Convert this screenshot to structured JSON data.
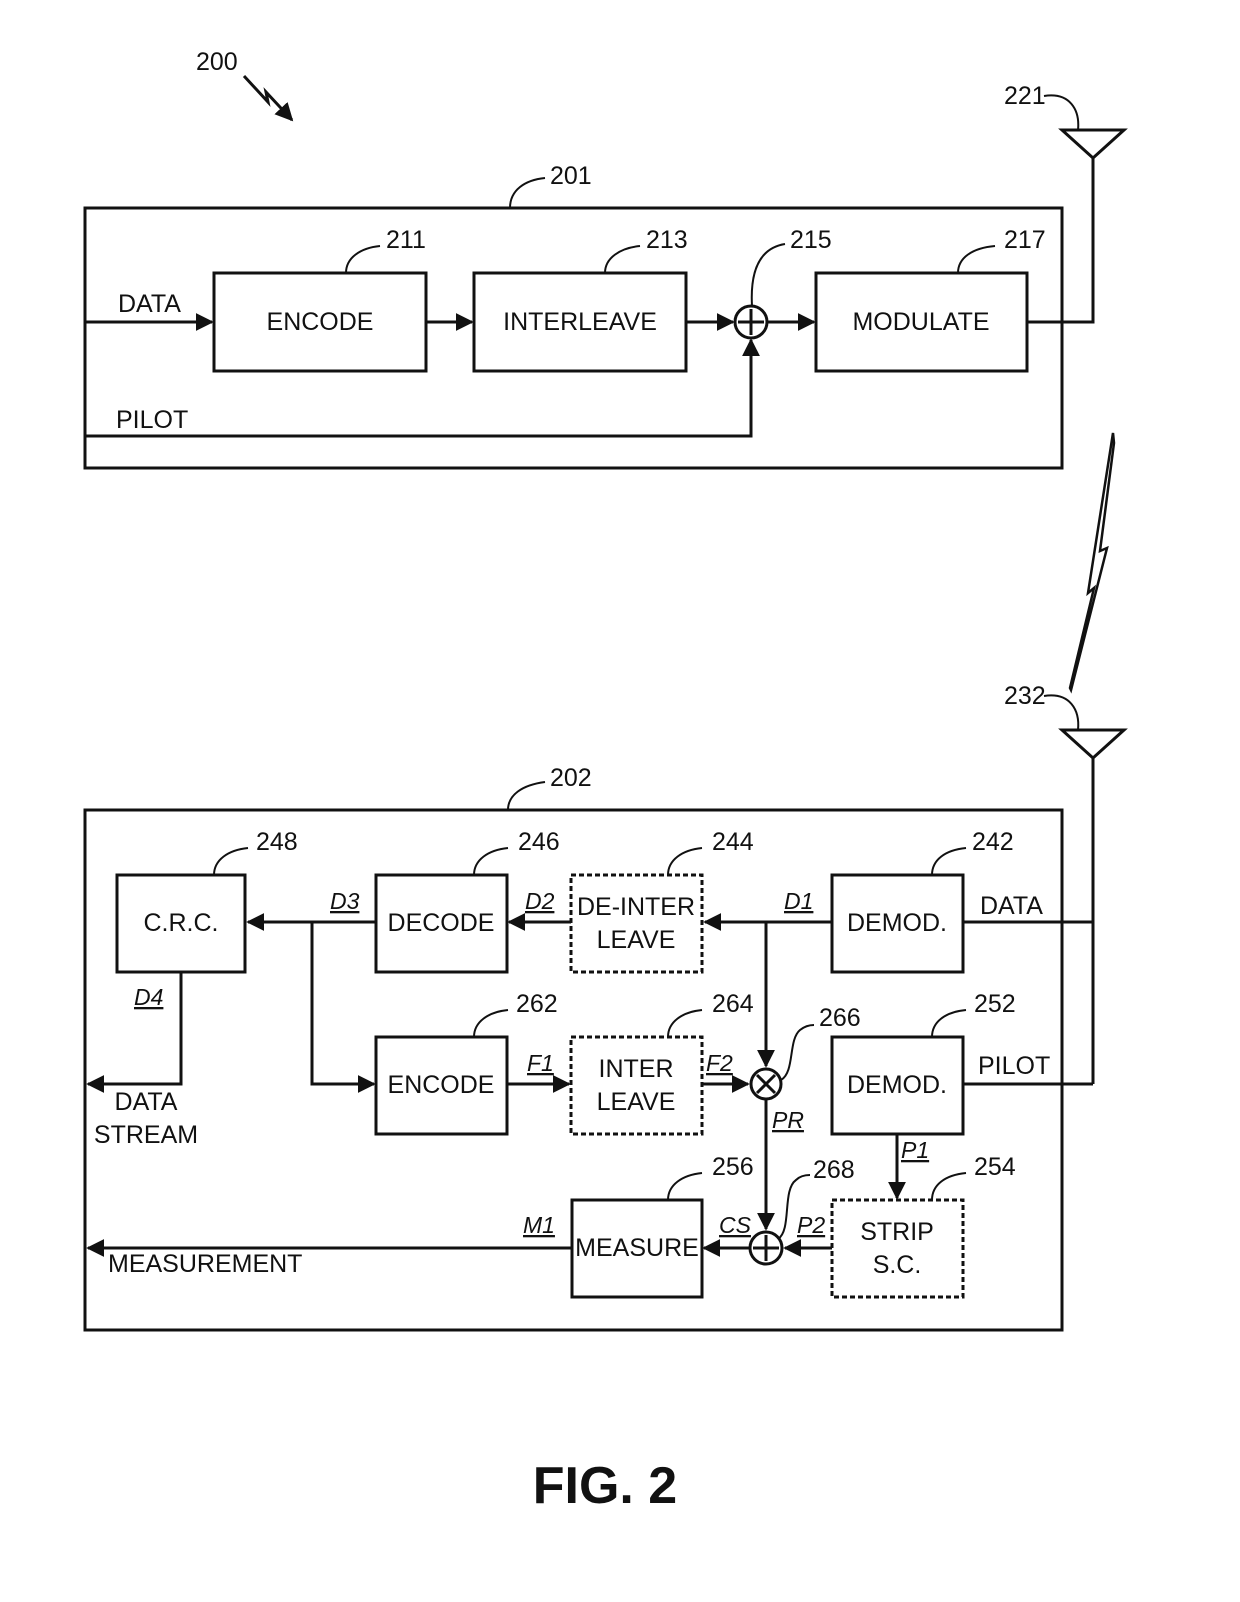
{
  "figure": {
    "label": "FIG. 2",
    "system_ref": "200"
  },
  "transmitter": {
    "ref": "201",
    "antenna_ref": "221",
    "inputs": {
      "data": "DATA",
      "pilot": "PILOT"
    },
    "blocks": {
      "encode": {
        "label": "ENCODE",
        "ref": "211"
      },
      "interleave": {
        "label": "INTERLEAVE",
        "ref": "213"
      },
      "adder": {
        "ref": "215"
      },
      "modulate": {
        "label": "MODULATE",
        "ref": "217"
      }
    }
  },
  "receiver": {
    "ref": "202",
    "antenna_ref": "232",
    "branch_labels": {
      "data": "DATA",
      "pilot": "PILOT"
    },
    "blocks": {
      "demod_data": {
        "label": "DEMOD.",
        "ref": "242"
      },
      "deinterleave": {
        "line1": "DE-INTER",
        "line2": "LEAVE",
        "ref": "244"
      },
      "decode": {
        "label": "DECODE",
        "ref": "246"
      },
      "crc": {
        "label": "C.R.C.",
        "ref": "248"
      },
      "demod_pilot": {
        "label": "DEMOD.",
        "ref": "252"
      },
      "strip": {
        "line1": "STRIP",
        "line2": "S.C.",
        "ref": "254"
      },
      "measure": {
        "label": "MEASURE",
        "ref": "256"
      },
      "encode": {
        "label": "ENCODE",
        "ref": "262"
      },
      "interleave": {
        "line1": "INTER",
        "line2": "LEAVE",
        "ref": "264"
      },
      "multiplier": {
        "ref": "266"
      },
      "adder": {
        "ref": "268"
      }
    },
    "signals": {
      "d1": "D1",
      "d2": "D2",
      "d3": "D3",
      "d4": "D4",
      "f1": "F1",
      "f2": "F2",
      "pr": "PR",
      "p1": "P1",
      "p2": "P2",
      "cs": "CS",
      "m1": "M1"
    },
    "outputs": {
      "data_stream_line1": "DATA",
      "data_stream_line2": "STREAM",
      "measurement": "MEASUREMENT"
    }
  }
}
